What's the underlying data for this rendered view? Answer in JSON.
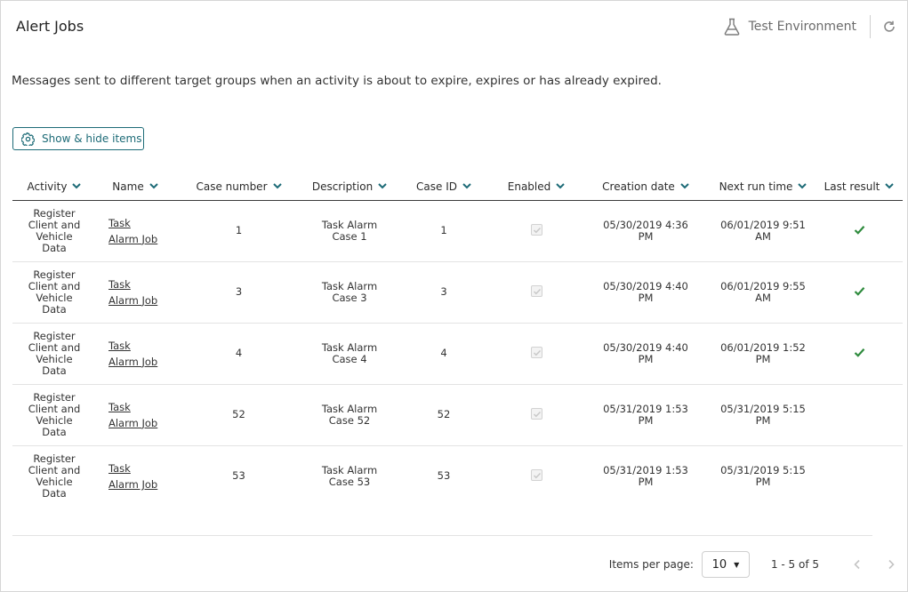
{
  "page": {
    "title": "Alert Jobs"
  },
  "environment": {
    "label": "Test Environment",
    "icon": "flask-icon",
    "refresh_icon": "refresh-icon"
  },
  "intro": "Messages sent to different target groups when an activity is about to expire, expires or has already expired.",
  "toolbar": {
    "show_hide_label": "Show & hide items",
    "show_hide_icon": "gear-icon"
  },
  "colors": {
    "accent": "#1d6b77",
    "success": "#2e8b3d"
  },
  "table": {
    "columns": [
      "Activity",
      "Name",
      "Case number",
      "Description",
      "Case ID",
      "Enabled",
      "Creation date",
      "Next run time",
      "Last result"
    ],
    "rows": [
      {
        "activity": "Register Client and Vehicle Data",
        "name": "Task Alarm Job",
        "case_number": "1",
        "description": "Task Alarm Case 1",
        "case_id": "1",
        "enabled": true,
        "creation_date": "05/30/2019 4:36 PM",
        "next_run_time": "06/01/2019 9:51 AM",
        "last_result": "success"
      },
      {
        "activity": "Register Client and Vehicle Data",
        "name": "Task Alarm Job",
        "case_number": "3",
        "description": "Task Alarm Case 3",
        "case_id": "3",
        "enabled": true,
        "creation_date": "05/30/2019 4:40 PM",
        "next_run_time": "06/01/2019 9:55 AM",
        "last_result": "success"
      },
      {
        "activity": "Register Client and Vehicle Data",
        "name": "Task Alarm Job",
        "case_number": "4",
        "description": "Task Alarm Case 4",
        "case_id": "4",
        "enabled": true,
        "creation_date": "05/30/2019 4:40 PM",
        "next_run_time": "06/01/2019 1:52 PM",
        "last_result": "success"
      },
      {
        "activity": "Register Client and Vehicle Data",
        "name": "Task Alarm Job",
        "case_number": "52",
        "description": "Task Alarm Case 52",
        "case_id": "52",
        "enabled": true,
        "creation_date": "05/31/2019 1:53 PM",
        "next_run_time": "05/31/2019 5:15 PM",
        "last_result": ""
      },
      {
        "activity": "Register Client and Vehicle Data",
        "name": "Task Alarm Job",
        "case_number": "53",
        "description": "Task Alarm Case 53",
        "case_id": "53",
        "enabled": true,
        "creation_date": "05/31/2019 1:53 PM",
        "next_run_time": "05/31/2019 5:15 PM",
        "last_result": ""
      }
    ]
  },
  "pagination": {
    "items_per_page_label": "Items per page:",
    "items_per_page": "10",
    "range_text": "1 - 5 of 5"
  }
}
